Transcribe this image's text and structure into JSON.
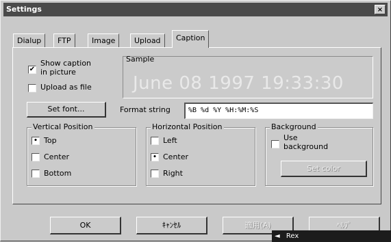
{
  "window": {
    "title": "Settings",
    "close_glyph": "×"
  },
  "tabs": [
    "Dialup",
    "FTP",
    "Image",
    "Upload",
    "Caption"
  ],
  "active_tab": "Caption",
  "caption": {
    "show_caption_line1": "Show caption",
    "show_caption_line2": "in picture",
    "show_caption_checked": "✔",
    "upload_as_file": "Upload as file",
    "set_font": "Set font...",
    "sample_title": "Sample",
    "sample_text": "June 08 1997 19:33:30",
    "format_label": "Format string",
    "format_value": "%B %d %Y %H:%M:%S"
  },
  "vertical": {
    "title": "Vertical Position",
    "options": [
      "Top",
      "Center",
      "Bottom"
    ],
    "selected_mark": "•"
  },
  "horizontal": {
    "title": "Horizontal Position",
    "options": [
      "Left",
      "Center",
      "Right"
    ],
    "selected_mark": "•"
  },
  "background": {
    "title": "Background",
    "use_line1": "Use",
    "use_line2": "background",
    "set_color": "Set color"
  },
  "buttons": {
    "ok": "OK",
    "cancel": "ｷｬﾝｾﾙ",
    "apply": "適用(A)",
    "help": "ﾍﾙﾌﾟ"
  },
  "taskbar_popup": {
    "icon": "◄",
    "label": "Rex"
  }
}
